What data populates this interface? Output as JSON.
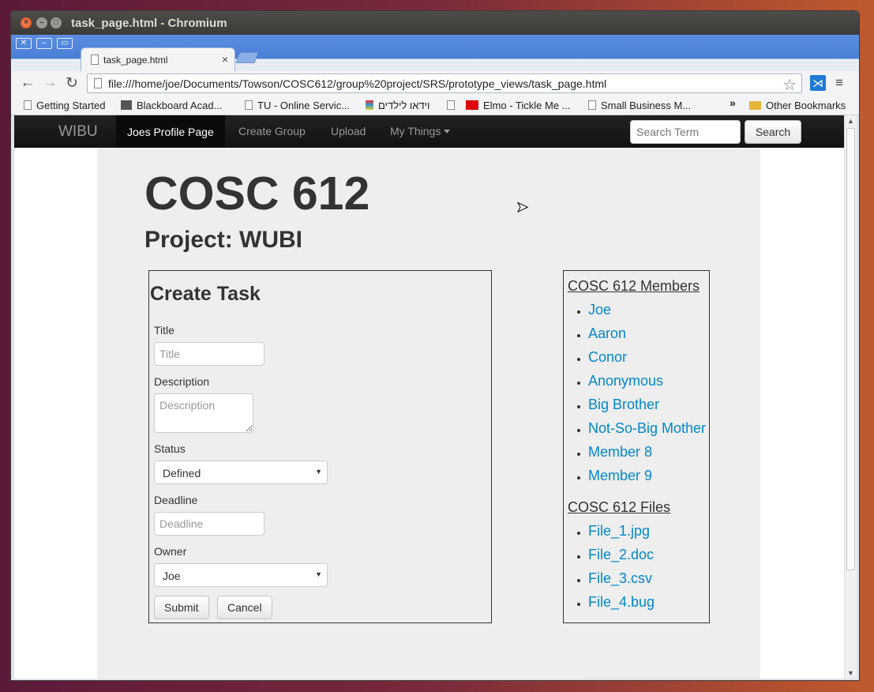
{
  "window": {
    "title": "task_page.html - Chromium"
  },
  "tab": {
    "title": "task_page.html"
  },
  "address": {
    "url": "file:///home/joe/Documents/Towson/COSC612/group%20project/SRS/prototype_views/task_page.html"
  },
  "bookmarks": {
    "items": [
      "Getting Started",
      "Blackboard Acad...",
      "TU - Online Servic...",
      "וידאו לילדים",
      "Elmo - Tickle Me ...",
      "Small Business M..."
    ],
    "more": "»",
    "other": "Other Bookmarks"
  },
  "navbar": {
    "brand": "WIBU",
    "links": [
      "Joes Profile Page",
      "Create Group",
      "Upload",
      "My Things"
    ],
    "search_placeholder": "Search Term",
    "search_button": "Search"
  },
  "page": {
    "course": "COSC 612",
    "project": "Project: WUBI"
  },
  "form": {
    "title": "Create Task",
    "title_label": "Title",
    "title_placeholder": "Title",
    "description_label": "Description",
    "description_placeholder": "Description",
    "status_label": "Status",
    "status_value": "Defined",
    "deadline_label": "Deadline",
    "deadline_placeholder": "Deadline",
    "owner_label": "Owner",
    "owner_value": "Joe",
    "submit": "Submit",
    "cancel": "Cancel"
  },
  "members": {
    "heading": "COSC 612 Members",
    "items": [
      "Joe",
      "Aaron",
      "Conor",
      "Anonymous",
      "Big Brother",
      "Not-So-Big Mother",
      "Member 8",
      "Member 9"
    ]
  },
  "files": {
    "heading": "COSC 612 Files",
    "items": [
      "File_1.jpg",
      "File_2.doc",
      "File_3.csv",
      "File_4.bug"
    ]
  },
  "icons": {
    "close": "×",
    "minimize": "–",
    "maximize": "□",
    "back": "←",
    "forward": "→",
    "reload": "↻",
    "star": "☆",
    "menu": "≡",
    "ext": "⋊",
    "cursor": "➤"
  }
}
